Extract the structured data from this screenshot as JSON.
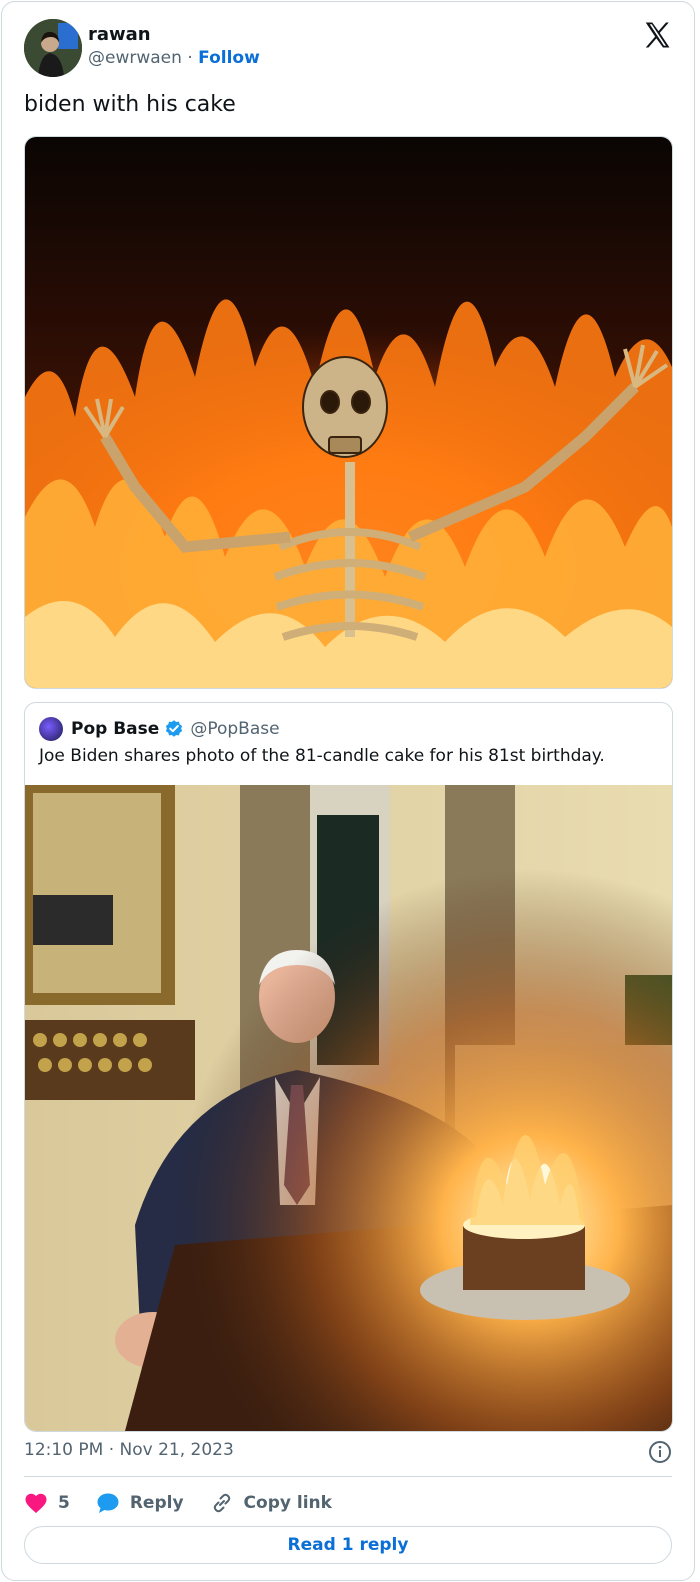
{
  "author": {
    "display_name": "rawan",
    "handle": "@ewrwaen",
    "separator": "·",
    "follow_label": "Follow"
  },
  "tweet": {
    "text": "biden with his cake"
  },
  "quoted_tweet": {
    "name": "Pop Base",
    "handle": "@PopBase",
    "text": "Joe Biden shares photo of the 81-candle cake for his 81st birthday."
  },
  "meta": {
    "timestamp": "12:10 PM · Nov 21, 2023"
  },
  "actions": {
    "like_count": "5",
    "reply_label": "Reply",
    "copy_label": "Copy link"
  },
  "read_replies_label": "Read 1 reply",
  "colors": {
    "accent": "#1d9bf0",
    "like": "#f91880",
    "verified": "#1d9bf0"
  }
}
